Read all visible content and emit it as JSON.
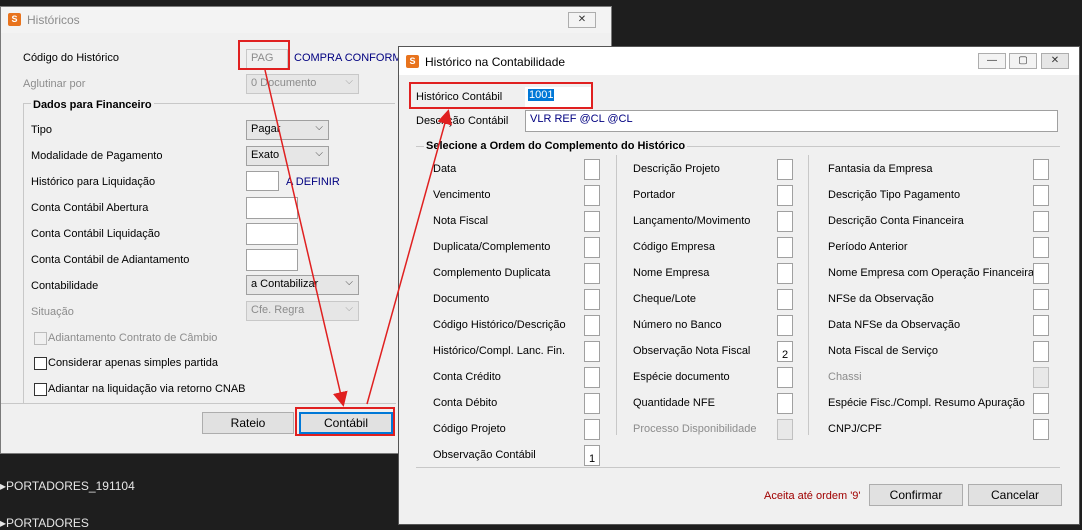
{
  "background": {
    "line1": "PORTADORES_191104",
    "line2": "PORTADORES"
  },
  "historicos": {
    "title": "Históricos",
    "close_glyph": "✕",
    "codigo_label": "Código do Histórico",
    "codigo_value": "PAG",
    "codigo_desc": "COMPRA CONFORME",
    "aglutinar_label": "Aglutinar por",
    "aglutinar_value": "0 Documento",
    "dados_title": "Dados para Financeiro",
    "tipo_label": "Tipo",
    "tipo_value": "Pagar",
    "modalidade_label": "Modalidade de Pagamento",
    "modalidade_value": "Exato",
    "hist_liq_label": "Histórico para Liquidação",
    "hist_liq_value": "",
    "hist_liq_desc": "A DEFINIR",
    "conta_abertura_label": "Conta Contábil Abertura",
    "conta_liq_label": "Conta Contábil Liquidação",
    "conta_adiant_label": "Conta Contábil de Adiantamento",
    "contabilidade_label": "Contabilidade",
    "contabilidade_value": "a Contabilizar",
    "situacao_label": "Situação",
    "situacao_value": "Cfe. Regra",
    "adiant_cambio_label": "Adiantamento Contrato de Câmbio",
    "simples_label": "Considerar apenas simples partida",
    "cnab_label": "Adiantar na liquidação via retorno CNAB",
    "rateio_button": "Rateio",
    "contabil_button": "Contábil"
  },
  "contabilidade": {
    "title": "Histórico na Contabilidade",
    "minimize_glyph": "—",
    "maximize_glyph": "▢",
    "close_glyph": "✕",
    "hist_contabil_label": "Histórico Contábil",
    "hist_contabil_value": "1001",
    "descricao_label": "Descrição Contábil",
    "descricao_value": "VLR REF @CL @CL",
    "ordem_title": "Selecione a Ordem do Complemento do Histórico",
    "col1": [
      {
        "label": "Data",
        "value": ""
      },
      {
        "label": "Vencimento",
        "value": ""
      },
      {
        "label": "Nota Fiscal",
        "value": ""
      },
      {
        "label": "Duplicata/Complemento",
        "value": ""
      },
      {
        "label": "Complemento Duplicata",
        "value": ""
      },
      {
        "label": "Documento",
        "value": ""
      },
      {
        "label": "Código Histórico/Descrição",
        "value": ""
      },
      {
        "label": "Histórico/Compl. Lanc. Fin.",
        "value": ""
      },
      {
        "label": "Conta Crédito",
        "value": ""
      },
      {
        "label": "Conta Débito",
        "value": ""
      },
      {
        "label": "Código Projeto",
        "value": ""
      },
      {
        "label": "Observação Contábil",
        "value": "1"
      }
    ],
    "col2": [
      {
        "label": "Descrição Projeto",
        "value": ""
      },
      {
        "label": "Portador",
        "value": ""
      },
      {
        "label": "Lançamento/Movimento",
        "value": ""
      },
      {
        "label": "Código Empresa",
        "value": ""
      },
      {
        "label": "Nome Empresa",
        "value": ""
      },
      {
        "label": "Cheque/Lote",
        "value": ""
      },
      {
        "label": "Número no Banco",
        "value": ""
      },
      {
        "label": "Observação Nota Fiscal",
        "value": "2"
      },
      {
        "label": "Espécie documento",
        "value": ""
      },
      {
        "label": "Quantidade NFE",
        "value": ""
      },
      {
        "label": "Processo Disponibilidade",
        "value": ""
      }
    ],
    "col3": [
      {
        "label": "Fantasia da Empresa",
        "value": ""
      },
      {
        "label": "Descrição Tipo Pagamento",
        "value": ""
      },
      {
        "label": "Descrição Conta Financeira",
        "value": ""
      },
      {
        "label": "Período Anterior",
        "value": ""
      },
      {
        "label": "Nome Empresa com Operação Financeira",
        "value": ""
      },
      {
        "label": "NFSe da Observação",
        "value": ""
      },
      {
        "label": "Data NFSe da Observação",
        "value": ""
      },
      {
        "label": "Nota Fiscal de Serviço",
        "value": ""
      },
      {
        "label": "Chassi",
        "value": ""
      },
      {
        "label": "Espécie Fisc./Compl. Resumo Apuração",
        "value": ""
      },
      {
        "label": "CNPJ/CPF",
        "value": ""
      }
    ],
    "aceita_text": "Aceita até ordem '9'",
    "confirmar_button": "Confirmar",
    "cancelar_button": "Cancelar"
  },
  "colors": {
    "accent_red": "#e02020",
    "selection_blue": "#0078d7",
    "link_blue": "#000080",
    "warning_text": "#a00000"
  }
}
